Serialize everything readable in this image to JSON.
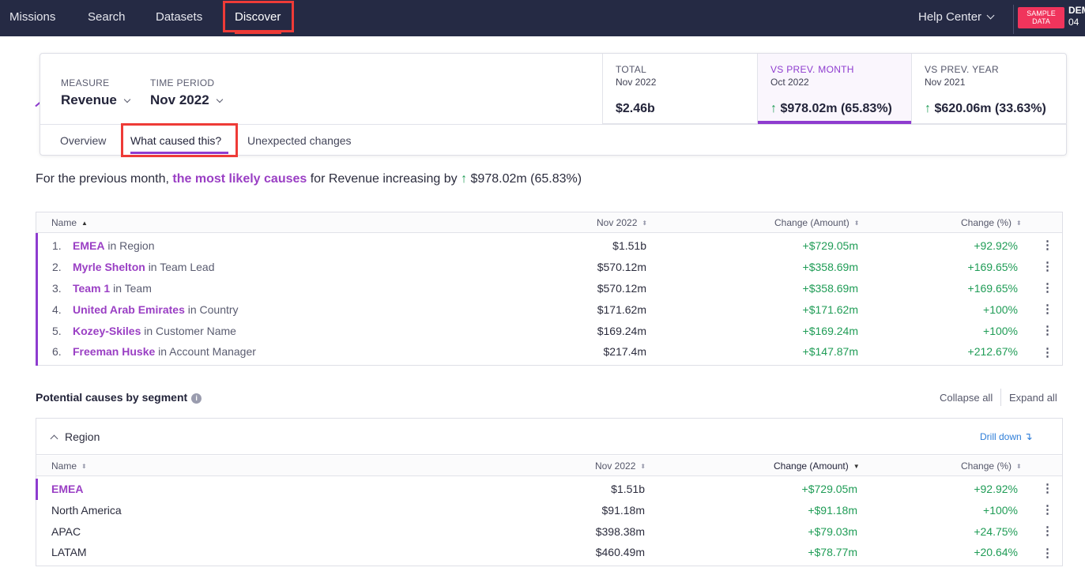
{
  "nav": {
    "items": [
      "Missions",
      "Search",
      "Datasets",
      "Discover"
    ],
    "help_label": "Help Center",
    "sample_label": "SAMPLE DATA",
    "demo_line1": "DEM",
    "demo_line2": "04"
  },
  "card": {
    "measure_label": "MEASURE",
    "measure_value": "Revenue",
    "period_label": "TIME PERIOD",
    "period_value": "Nov 2022",
    "metrics": [
      {
        "label": "TOTAL",
        "sub": "Nov 2022",
        "value": "$2.46b",
        "arrow": ""
      },
      {
        "label": "VS PREV. MONTH",
        "sub": "Oct 2022",
        "value": "$978.02m (65.83%)",
        "arrow": "↑"
      },
      {
        "label": "VS PREV. YEAR",
        "sub": "Nov 2021",
        "value": "$620.06m (33.63%)",
        "arrow": "↑"
      }
    ],
    "tabs": [
      "Overview",
      "What caused this?",
      "Unexpected changes"
    ]
  },
  "summary": {
    "prefix": "For the previous month,",
    "highlight": "the most likely causes",
    "middle": "for Revenue increasing by",
    "arrow": "↑",
    "value": "$978.02m (65.83%)"
  },
  "causes_table": {
    "headers": [
      "Name",
      "Nov 2022",
      "Change (Amount)",
      "Change (%)"
    ],
    "rows": [
      {
        "rank": "1.",
        "entity": "EMEA",
        "dimension": "in Region",
        "value": "$1.51b",
        "change_amount": "+$729.05m",
        "change_pct": "+92.92%"
      },
      {
        "rank": "2.",
        "entity": "Myrle Shelton",
        "dimension": "in Team Lead",
        "value": "$570.12m",
        "change_amount": "+$358.69m",
        "change_pct": "+169.65%"
      },
      {
        "rank": "3.",
        "entity": "Team 1",
        "dimension": "in Team",
        "value": "$570.12m",
        "change_amount": "+$358.69m",
        "change_pct": "+169.65%"
      },
      {
        "rank": "4.",
        "entity": "United Arab Emirates",
        "dimension": "in Country",
        "value": "$171.62m",
        "change_amount": "+$171.62m",
        "change_pct": "+100%"
      },
      {
        "rank": "5.",
        "entity": "Kozey-Skiles",
        "dimension": "in Customer Name",
        "value": "$169.24m",
        "change_amount": "+$169.24m",
        "change_pct": "+100%"
      },
      {
        "rank": "6.",
        "entity": "Freeman Huske",
        "dimension": "in Account Manager",
        "value": "$217.4m",
        "change_amount": "+$147.87m",
        "change_pct": "+212.67%"
      }
    ]
  },
  "segments": {
    "title": "Potential causes by segment",
    "info_icon": "i",
    "collapse_label": "Collapse all",
    "expand_label": "Expand all",
    "region": {
      "name": "Region",
      "drill_label": "Drill down",
      "drill_icon": "↴",
      "headers": [
        "Name",
        "Nov 2022",
        "Change (Amount)",
        "Change (%)"
      ],
      "rows": [
        {
          "name": "EMEA",
          "value": "$1.51b",
          "change_amount": "+$729.05m",
          "change_pct": "+92.92%"
        },
        {
          "name": "North America",
          "value": "$91.18m",
          "change_amount": "+$91.18m",
          "change_pct": "+100%"
        },
        {
          "name": "APAC",
          "value": "$398.38m",
          "change_amount": "+$79.03m",
          "change_pct": "+24.75%"
        },
        {
          "name": "LATAM",
          "value": "$460.49m",
          "change_amount": "+$78.77m",
          "change_pct": "+20.64%"
        }
      ]
    }
  },
  "colors": {
    "nav_bg": "#252a44",
    "accent_purple": "#8e3ccf",
    "positive_green": "#1f9c56",
    "highlight_red": "#ee3b37",
    "sample_badge": "#f0345c"
  }
}
